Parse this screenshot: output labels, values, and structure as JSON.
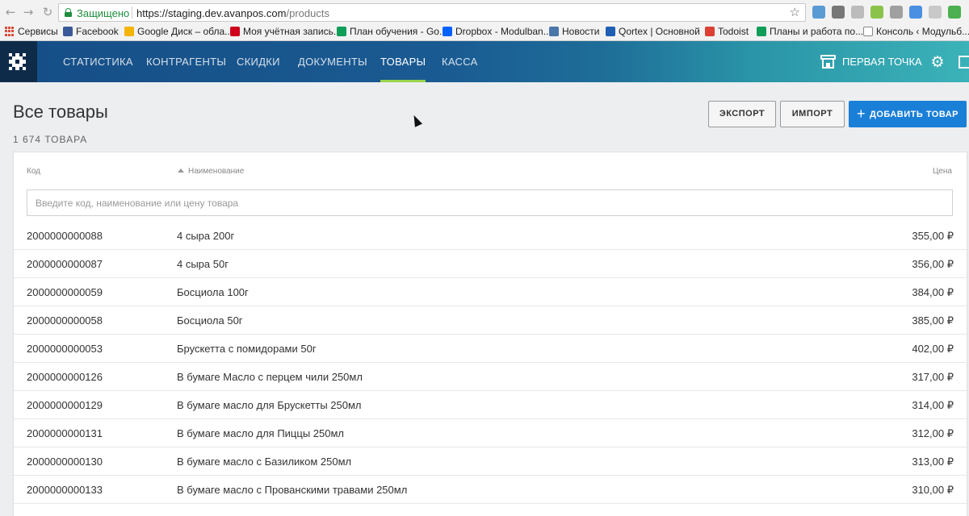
{
  "browser": {
    "secure_label": "Защищено",
    "url_host": "https://staging.dev.avanpos.com",
    "url_path": "/products",
    "bookmarks": [
      {
        "label": "Сервисы",
        "color": "#d94a38"
      },
      {
        "label": "Facebook",
        "color": "#3b5998"
      },
      {
        "label": "Google Диск – обла...",
        "color": "#f4b400"
      },
      {
        "label": "Моя учётная запись...",
        "color": "#d0021b"
      },
      {
        "label": "План обучения - Go...",
        "color": "#0f9d58"
      },
      {
        "label": "Dropbox - Modulban...",
        "color": "#0061fe"
      },
      {
        "label": "Новости",
        "color": "#4a76a8"
      },
      {
        "label": "Qortex | Основной",
        "color": "#1e5fb4"
      },
      {
        "label": "Todoist",
        "color": "#db4035"
      },
      {
        "label": "Планы и работа по...",
        "color": "#0f9d58"
      },
      {
        "label": "Консоль ‹ Модульб...",
        "color": "#888888"
      }
    ]
  },
  "nav": {
    "items": [
      "СТАТИСТИКА",
      "КОНТРАГЕНТЫ",
      "СКИДКИ",
      "ДОКУМЕНТЫ",
      "ТОВАРЫ",
      "КАССА"
    ],
    "active": "ТОВАРЫ",
    "store": "ПЕРВАЯ ТОЧКА"
  },
  "page": {
    "title": "Все товары",
    "count": "1 674 ТОВАРА",
    "export": "ЭКСПОРТ",
    "import": "ИМПОРТ",
    "add": "ДОБАВИТЬ ТОВАР"
  },
  "table": {
    "col_code": "Код",
    "col_name": "Наименование",
    "col_price": "Цена",
    "search_placeholder": "Введите код, наименование или цену товара",
    "rows": [
      {
        "code": "2000000000088",
        "name": "4 сыра 200г",
        "price": "355,00 ₽"
      },
      {
        "code": "2000000000087",
        "name": "4 сыра 50г",
        "price": "356,00 ₽"
      },
      {
        "code": "2000000000059",
        "name": "Босциола 100г",
        "price": "384,00 ₽"
      },
      {
        "code": "2000000000058",
        "name": "Босциола 50г",
        "price": "385,00 ₽"
      },
      {
        "code": "2000000000053",
        "name": "Брускетта с помидорами 50г",
        "price": "402,00 ₽"
      },
      {
        "code": "2000000000126",
        "name": "В бумаге Масло с перцем чили 250мл",
        "price": "317,00 ₽"
      },
      {
        "code": "2000000000129",
        "name": "В бумаге масло для Брускетты 250мл",
        "price": "314,00 ₽"
      },
      {
        "code": "2000000000131",
        "name": "В бумаге масло для Пиццы 250мл",
        "price": "312,00 ₽"
      },
      {
        "code": "2000000000130",
        "name": "В бумаге масло с Базиликом 250мл",
        "price": "313,00 ₽"
      },
      {
        "code": "2000000000133",
        "name": "В бумаге масло с Прованскими травами 250мл",
        "price": "310,00 ₽"
      }
    ]
  }
}
